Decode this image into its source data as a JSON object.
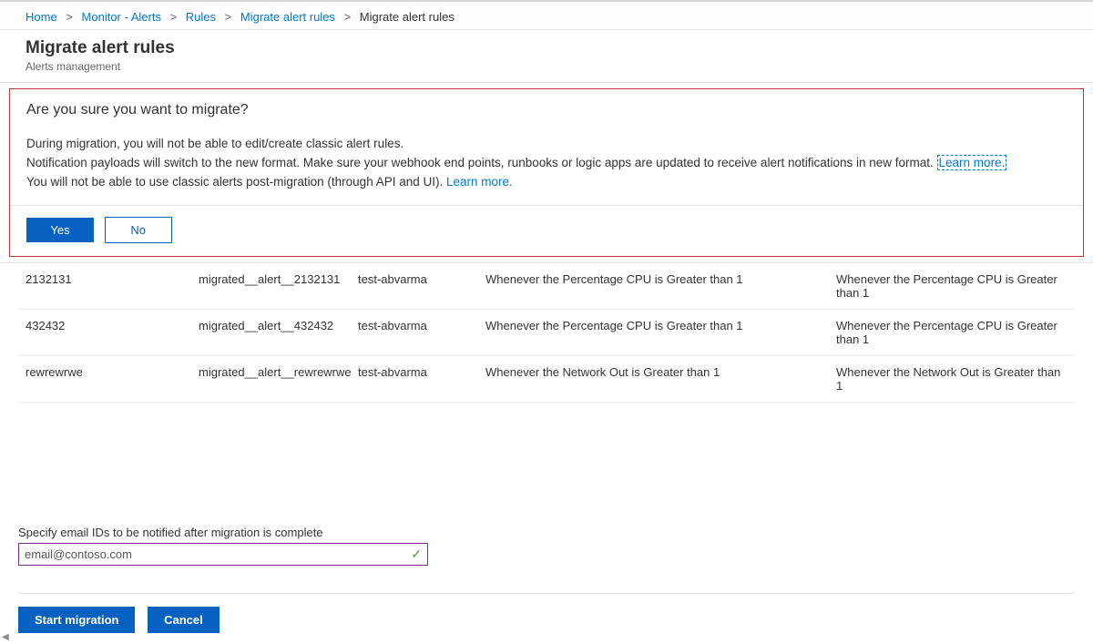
{
  "breadcrumb": {
    "items": [
      {
        "label": "Home",
        "link": true
      },
      {
        "label": "Monitor - Alerts",
        "link": true
      },
      {
        "label": "Rules",
        "link": true
      },
      {
        "label": "Migrate alert rules",
        "link": true
      },
      {
        "label": "Migrate alert rules",
        "link": false
      }
    ]
  },
  "header": {
    "title": "Migrate alert rules",
    "subtitle": "Alerts management"
  },
  "confirm": {
    "title": "Are you sure you want to migrate?",
    "line1": "During migration, you will not be able to edit/create classic alert rules.",
    "line2_a": "Notification payloads will switch to the new format. Make sure your webhook end points, runbooks or logic apps are updated to receive alert notifications in new format. ",
    "line2_link": "Learn more.",
    "line3_a": "You will not be able to use classic alerts post-migration (through API and UI). ",
    "line3_link": "Learn more.",
    "yes": "Yes",
    "no": "No"
  },
  "rows": [
    {
      "name": "2132131",
      "migrated": "migrated__alert__2132131",
      "resource": "test-abvarma",
      "cond1": "Whenever the Percentage CPU is Greater than 1",
      "cond2": "Whenever the Percentage CPU is Greater than 1"
    },
    {
      "name": "432432",
      "migrated": "migrated__alert__432432",
      "resource": "test-abvarma",
      "cond1": "Whenever the Percentage CPU is Greater than 1",
      "cond2": "Whenever the Percentage CPU is Greater than 1"
    },
    {
      "name": "rewrewrwe",
      "migrated": "migrated__alert__rewrewrwe",
      "resource": "test-abvarma",
      "cond1": "Whenever the Network Out is Greater than 1",
      "cond2": "Whenever the Network Out is Greater than 1"
    }
  ],
  "email": {
    "label": "Specify email IDs to be notified after migration is complete",
    "value": "email@contoso.com"
  },
  "bottom": {
    "start": "Start migration",
    "cancel": "Cancel"
  }
}
